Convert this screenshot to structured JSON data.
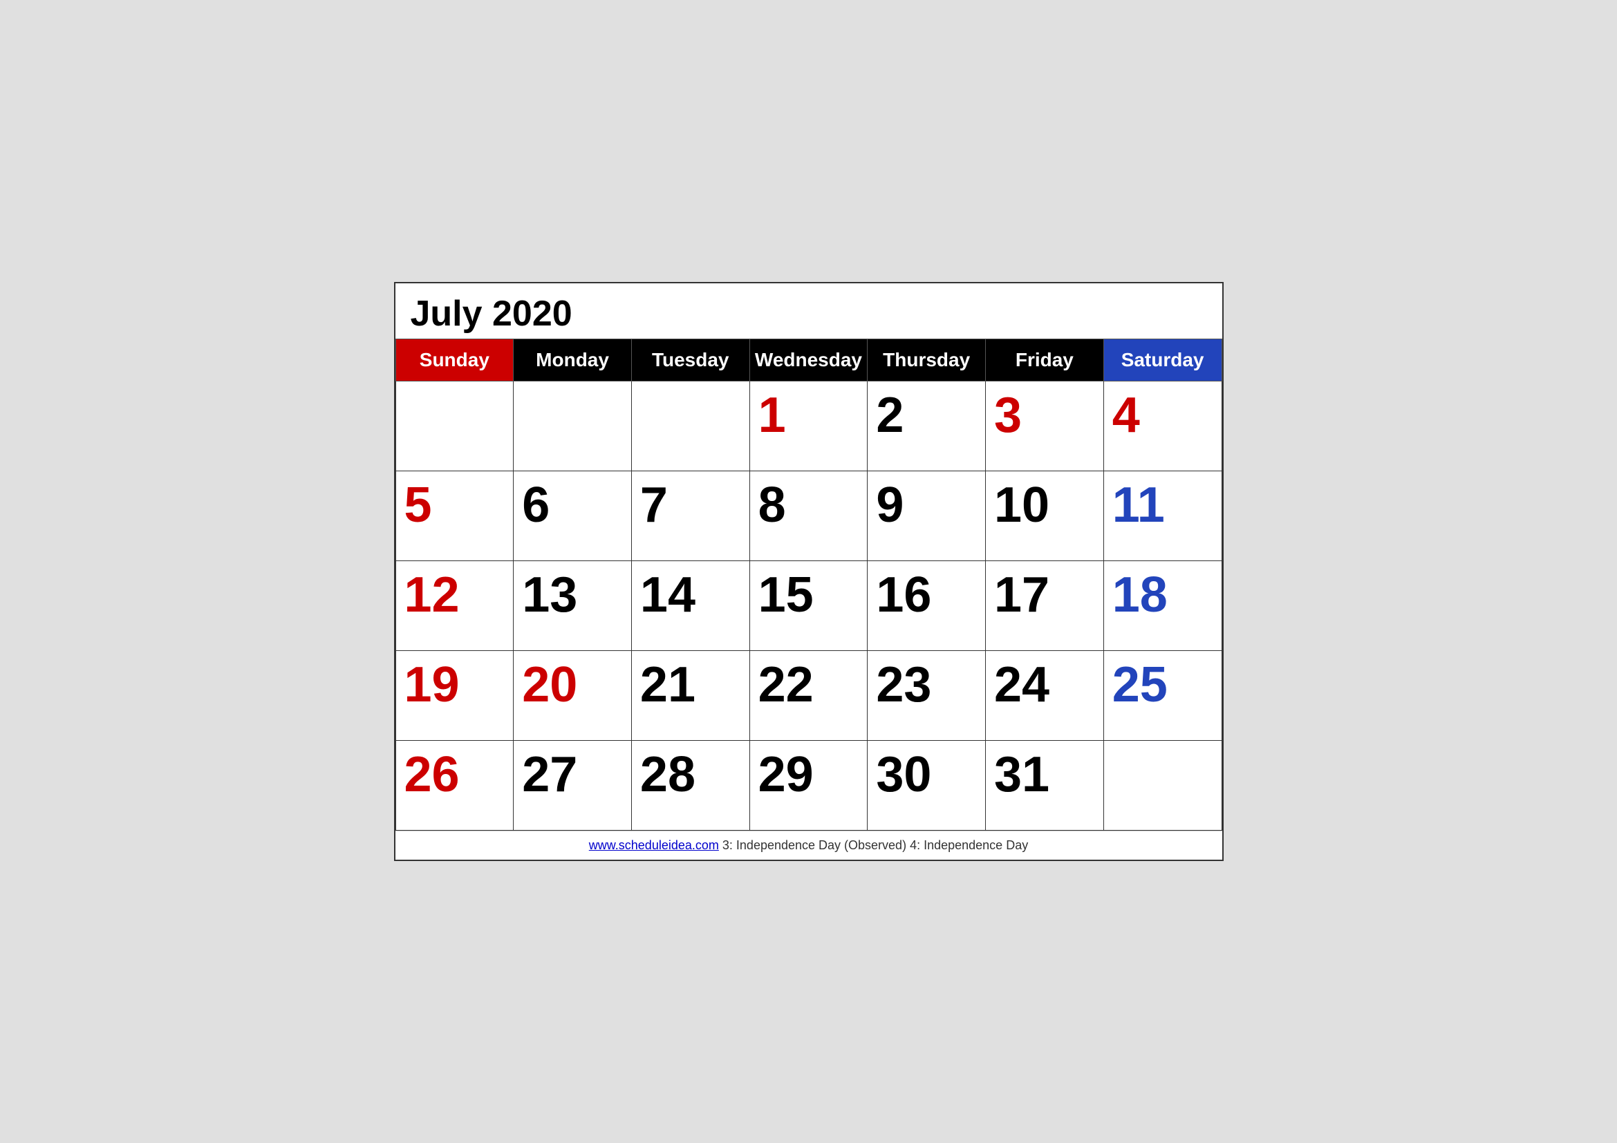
{
  "title": "July 2020",
  "headers": [
    {
      "label": "Sunday",
      "type": "sunday"
    },
    {
      "label": "Monday",
      "type": "weekday"
    },
    {
      "label": "Tuesday",
      "type": "weekday"
    },
    {
      "label": "Wednesday",
      "type": "weekday"
    },
    {
      "label": "Thursday",
      "type": "weekday"
    },
    {
      "label": "Friday",
      "type": "weekday"
    },
    {
      "label": "Saturday",
      "type": "saturday"
    }
  ],
  "weeks": [
    [
      {
        "day": "",
        "type": "sunday"
      },
      {
        "day": "",
        "type": "weekday"
      },
      {
        "day": "",
        "type": "weekday"
      },
      {
        "day": "1",
        "type": "holiday-red"
      },
      {
        "day": "2",
        "type": "weekday"
      },
      {
        "day": "3",
        "type": "holiday-red"
      },
      {
        "day": "4",
        "type": "saturday-red"
      }
    ],
    [
      {
        "day": "5",
        "type": "sunday"
      },
      {
        "day": "6",
        "type": "weekday"
      },
      {
        "day": "7",
        "type": "weekday"
      },
      {
        "day": "8",
        "type": "weekday"
      },
      {
        "day": "9",
        "type": "weekday"
      },
      {
        "day": "10",
        "type": "weekday"
      },
      {
        "day": "11",
        "type": "saturday"
      }
    ],
    [
      {
        "day": "12",
        "type": "sunday"
      },
      {
        "day": "13",
        "type": "weekday"
      },
      {
        "day": "14",
        "type": "weekday"
      },
      {
        "day": "15",
        "type": "weekday"
      },
      {
        "day": "16",
        "type": "weekday"
      },
      {
        "day": "17",
        "type": "weekday"
      },
      {
        "day": "18",
        "type": "saturday"
      }
    ],
    [
      {
        "day": "19",
        "type": "sunday"
      },
      {
        "day": "20",
        "type": "special-red"
      },
      {
        "day": "21",
        "type": "weekday"
      },
      {
        "day": "22",
        "type": "weekday"
      },
      {
        "day": "23",
        "type": "weekday"
      },
      {
        "day": "24",
        "type": "weekday"
      },
      {
        "day": "25",
        "type": "saturday"
      }
    ],
    [
      {
        "day": "26",
        "type": "sunday"
      },
      {
        "day": "27",
        "type": "weekday"
      },
      {
        "day": "28",
        "type": "weekday"
      },
      {
        "day": "29",
        "type": "weekday"
      },
      {
        "day": "30",
        "type": "weekday"
      },
      {
        "day": "31",
        "type": "weekday"
      },
      {
        "day": "",
        "type": "saturday"
      }
    ]
  ],
  "footer": {
    "website": "www.scheduleidea.com",
    "website_url": "http://www.scheduleidea.com",
    "notes": "3: Independence Day (Observed)     4: Independence Day"
  }
}
